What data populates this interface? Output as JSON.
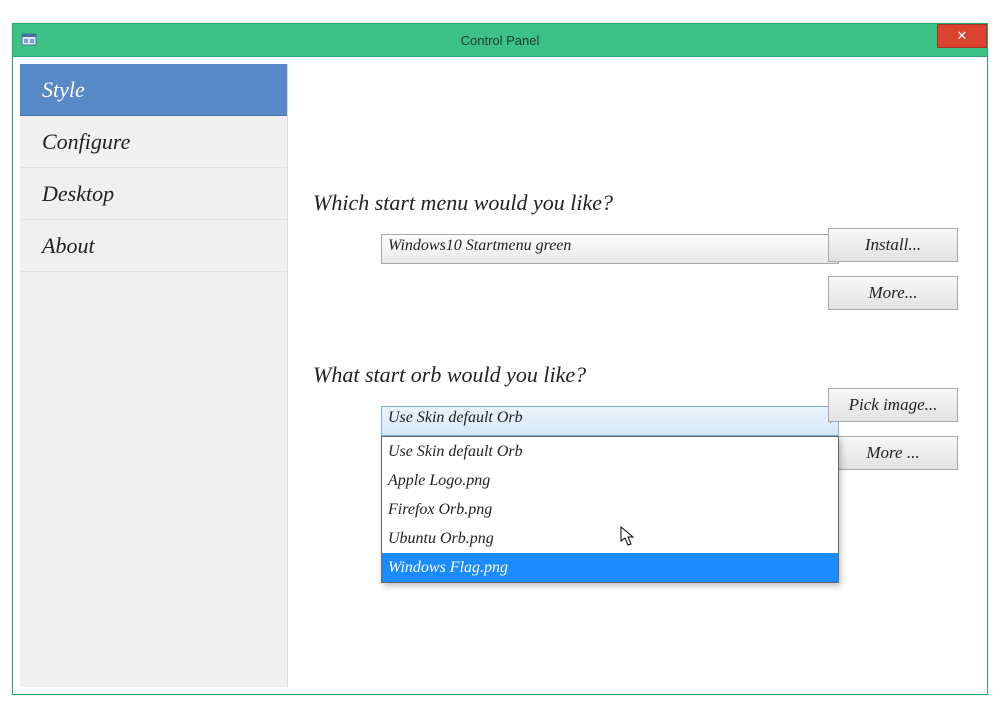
{
  "window": {
    "title": "Control Panel",
    "close_label": "✕"
  },
  "sidebar": {
    "items": [
      {
        "label": "Style",
        "selected": true
      },
      {
        "label": "Configure",
        "selected": false
      },
      {
        "label": "Desktop",
        "selected": false
      },
      {
        "label": "About",
        "selected": false
      }
    ]
  },
  "style_page": {
    "start_menu": {
      "title": "Which start menu would you like?",
      "selected": "Windows10 Startmenu green",
      "buttons": {
        "install": "Install...",
        "more": "More..."
      }
    },
    "start_orb": {
      "title": "What start orb would you like?",
      "selected": "Use Skin default Orb",
      "options": [
        "Use Skin default Orb",
        "Apple Logo.png",
        "Firefox Orb.png",
        "Ubuntu Orb.png",
        "Windows Flag.png"
      ],
      "highlighted_index": 4,
      "buttons": {
        "pick_image": "Pick image...",
        "more": "More ..."
      }
    }
  },
  "colors": {
    "titlebar": "#3cc187",
    "sidebar_selected": "#5889c7",
    "dropdown_highlight": "#1a8cff",
    "close_button": "#d9432f"
  }
}
